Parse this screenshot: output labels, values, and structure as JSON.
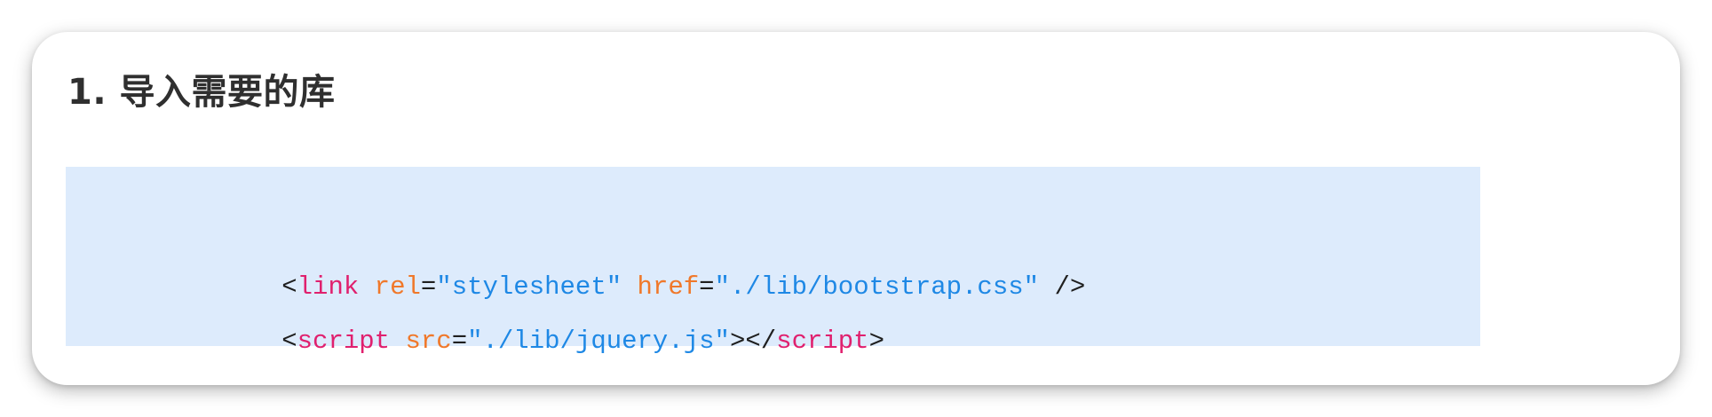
{
  "section": {
    "title": "1. 导入需要的库"
  },
  "code": {
    "lines": [
      [
        {
          "type": "punct",
          "text": "<"
        },
        {
          "type": "tag",
          "text": "link"
        },
        {
          "type": "punct",
          "text": " "
        },
        {
          "type": "attr",
          "text": "rel"
        },
        {
          "type": "punct",
          "text": "="
        },
        {
          "type": "str",
          "text": "\"stylesheet\""
        },
        {
          "type": "punct",
          "text": " "
        },
        {
          "type": "attr",
          "text": "href"
        },
        {
          "type": "punct",
          "text": "="
        },
        {
          "type": "str",
          "text": "\"./lib/bootstrap.css\""
        },
        {
          "type": "punct",
          "text": " />"
        }
      ],
      [
        {
          "type": "punct",
          "text": "<"
        },
        {
          "type": "tag",
          "text": "script"
        },
        {
          "type": "punct",
          "text": " "
        },
        {
          "type": "attr",
          "text": "src"
        },
        {
          "type": "punct",
          "text": "="
        },
        {
          "type": "str",
          "text": "\"./lib/jquery.js\""
        },
        {
          "type": "punct",
          "text": "></"
        },
        {
          "type": "tag",
          "text": "script"
        },
        {
          "type": "punct",
          "text": ">"
        }
      ]
    ]
  },
  "colors": {
    "code_background": "#ddebfc",
    "tag": "#e0206e",
    "attribute": "#f0782a",
    "string": "#1e88e5",
    "punctuation": "#1f1f1f",
    "heading": "#2f2f2f"
  }
}
